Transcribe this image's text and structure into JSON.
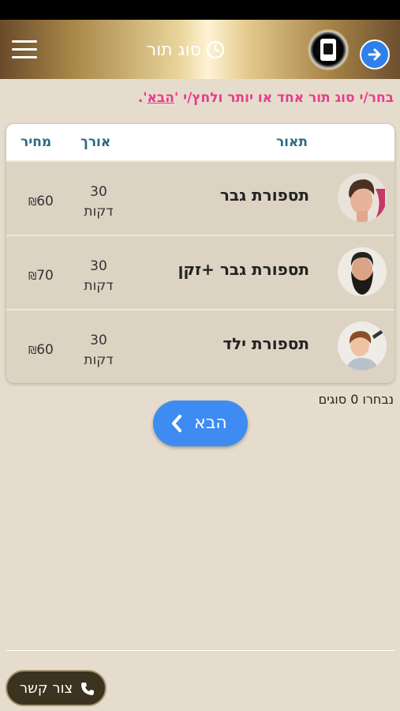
{
  "header": {
    "title": "סוג תור",
    "title_icon": "clock-icon",
    "menu_icon": "hamburger-menu-icon",
    "forward_icon": "arrow-right-icon",
    "logo_icon": "barbershop-logo"
  },
  "instruction": {
    "prefix": "בחר/י סוג תור אחד או יותר ולחץ/י '",
    "link": "הבא",
    "suffix": "'."
  },
  "table": {
    "columns": {
      "description": "תאור",
      "length": "אורך",
      "price": "מחיר"
    },
    "rows": [
      {
        "name": "תספורת גבר",
        "duration": "30",
        "unit": "דקות",
        "price": "60",
        "currency": "₪",
        "image": "man-haircut-photo"
      },
      {
        "name": "תספורת גבר +זקן",
        "duration": "30",
        "unit": "דקות",
        "price": "70",
        "currency": "₪",
        "image": "man-beard-photo"
      },
      {
        "name": "תספורת ילד",
        "duration": "30",
        "unit": "דקות",
        "price": "60",
        "currency": "₪",
        "image": "child-haircut-photo"
      }
    ]
  },
  "selected_count": "נבחרו 0 סוגים",
  "next_button": {
    "label": "הבא",
    "icon": "chevron-left-icon"
  },
  "contact_button": {
    "label": "צור קשר",
    "icon": "phone-icon"
  },
  "colors": {
    "background": "#e6dccd",
    "accent_pink": "#e63c8c",
    "button_blue": "#3e8cf2",
    "header_text_teal": "#2c6a86"
  }
}
